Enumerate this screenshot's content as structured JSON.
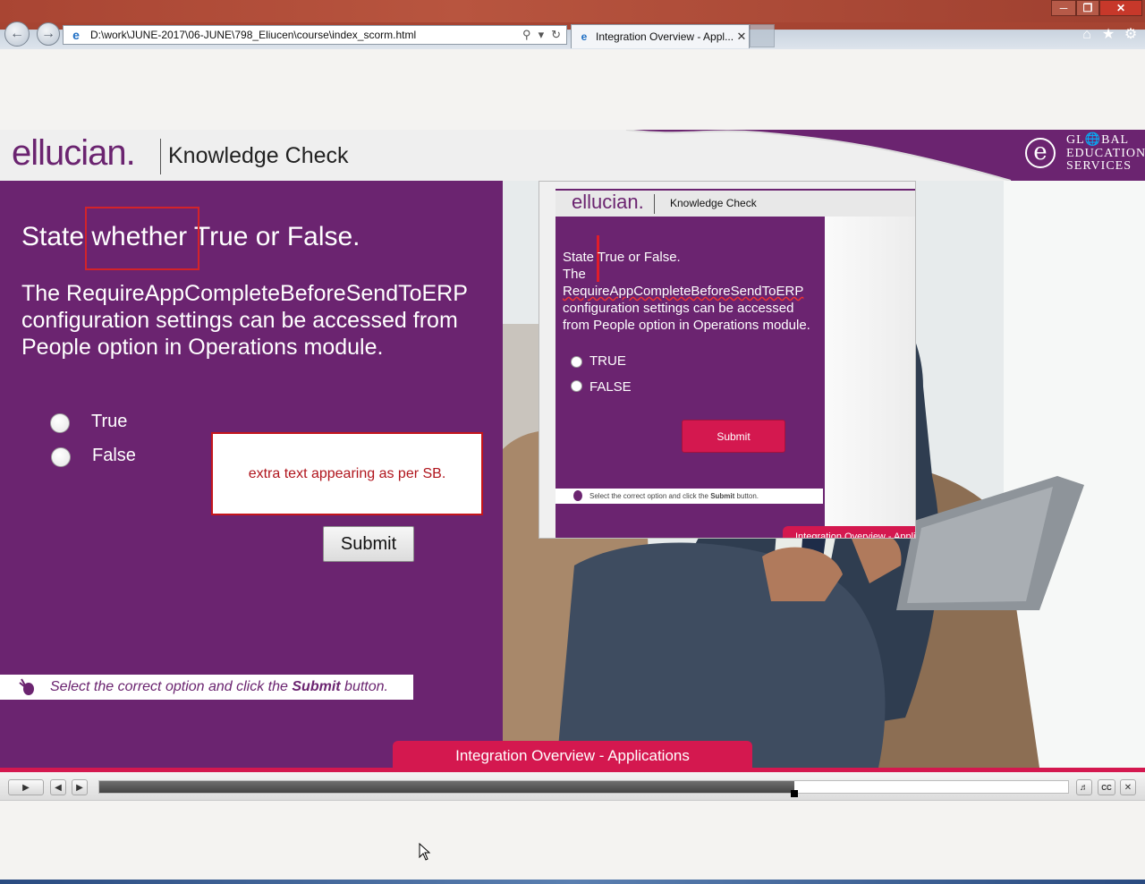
{
  "browser": {
    "address": "D:\\work\\JUNE-2017\\06-JUNE\\798_Eliucen\\course\\index_scorm.html",
    "tab_label": "Integration Overview - Appl...",
    "icons": [
      "back-icon",
      "forward-icon",
      "ie-page-icon",
      "search-icon",
      "refresh-icon",
      "home-icon",
      "favorites-icon",
      "settings-icon",
      "minimize-icon",
      "maximize-icon",
      "close-icon"
    ]
  },
  "course": {
    "logo": "ellucian.",
    "header_title": "Knowledge Check",
    "ges_logo": [
      "GL",
      "BAL",
      "EDUCATION",
      "SERVICES"
    ],
    "question_heading": "State whether True or False.",
    "question_text": "The RequireAppCompleteBeforeSendToERP configuration settings can be accessed from People option in Operations module.",
    "options": [
      "True",
      "False"
    ],
    "note_text": "extra text appearing as per SB.",
    "submit_label": "Submit",
    "instruction_prefix": "Select the correct option and click the ",
    "instruction_bold": "Submit",
    "instruction_suffix": " button.",
    "footer_tab": "Integration Overview - Applications"
  },
  "inner_screenshot": {
    "logo": "ellucian.",
    "title": "Knowledge Check",
    "q_line1": "State True or False.",
    "q_line2": "The",
    "q_line3": "RequireAppCompleteBeforeSendToERP",
    "q_line4": "configuration settings can be accessed",
    "q_line5": "from People option in Operations module.",
    "options": [
      "TRUE",
      "FALSE"
    ],
    "submit_label": "Submit",
    "instruction_prefix": "Select the correct option and click the ",
    "instruction_bold": "Submit",
    "instruction_suffix": " button.",
    "footer_tab": "Integration Overview - Appli"
  },
  "player": {
    "progress": 0.717,
    "buttons": [
      "play-icon",
      "prev-icon",
      "next-icon",
      "volume-icon",
      "cc-icon",
      "close-icon"
    ],
    "cc_label": "CC"
  },
  "colors": {
    "brand_purple": "#6b2470",
    "accent_pink": "#d4184f",
    "highlight_red": "#d3232a"
  }
}
